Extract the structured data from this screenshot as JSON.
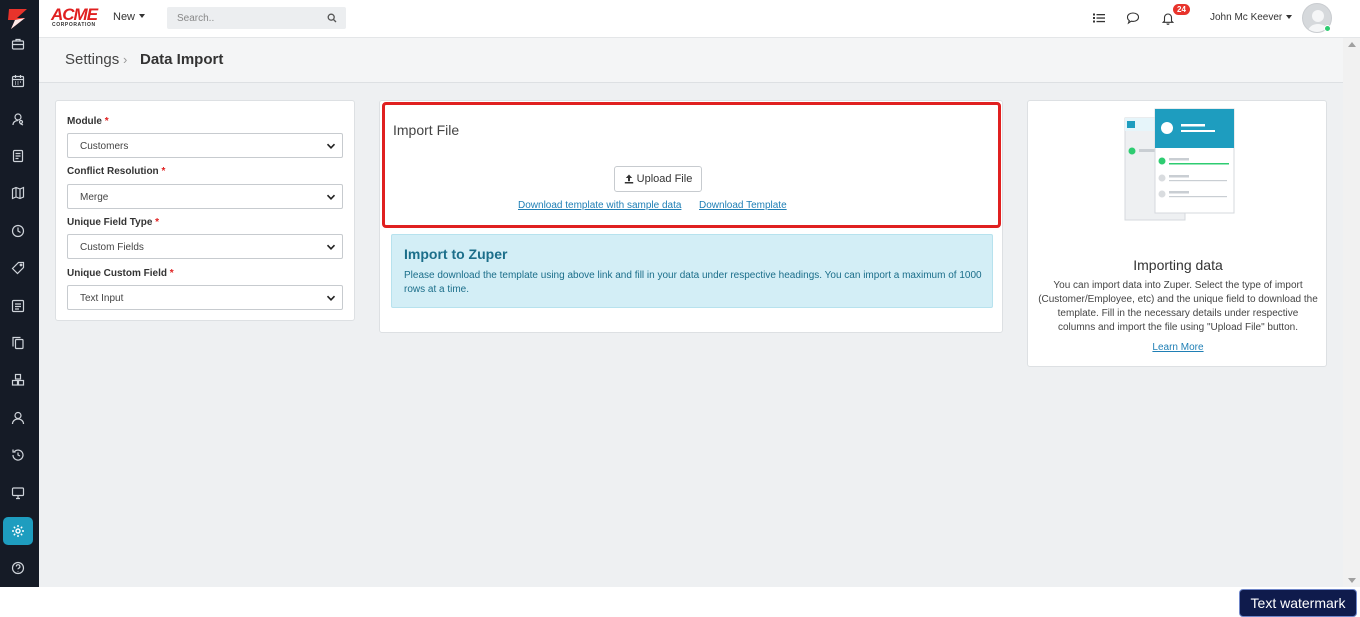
{
  "brand": {
    "name": "ACME",
    "tagline": "CORPORATION"
  },
  "header": {
    "new_label": "New",
    "search_placeholder": "Search..",
    "notification_count": "24",
    "user_name": "John Mc Keever"
  },
  "breadcrumb": {
    "parent": "Settings",
    "separator": "›",
    "current": "Data Import"
  },
  "form": {
    "module_label": "Module",
    "module_value": "Customers",
    "conflict_label": "Conflict Resolution",
    "conflict_value": "Merge",
    "unique_type_label": "Unique Field Type",
    "unique_type_value": "Custom Fields",
    "unique_custom_label": "Unique Custom Field",
    "unique_custom_value": "Text Input",
    "required_mark": "*"
  },
  "import": {
    "title": "Import File",
    "upload_label": "Upload File",
    "download_sample_label": "Download template with sample data",
    "download_template_label": "Download Template",
    "info_title": "Import to Zuper",
    "info_text": "Please download the template using above link and fill in your data under respective headings. You can import a maximum of 1000 rows at a time."
  },
  "help": {
    "title": "Importing data",
    "text": "You can import data into Zuper. Select the type of import (Customer/Employee, etc) and the unique field to download the template. Fill in the necessary details under respective columns and import the file using \"Upload File\" button.",
    "learn_more": "Learn More"
  },
  "watermark": "Text watermark",
  "colors": {
    "accent": "#1e9dbf",
    "highlight_border": "#e02020",
    "sidebar": "#151b26",
    "info_bg": "#d3eef6"
  }
}
